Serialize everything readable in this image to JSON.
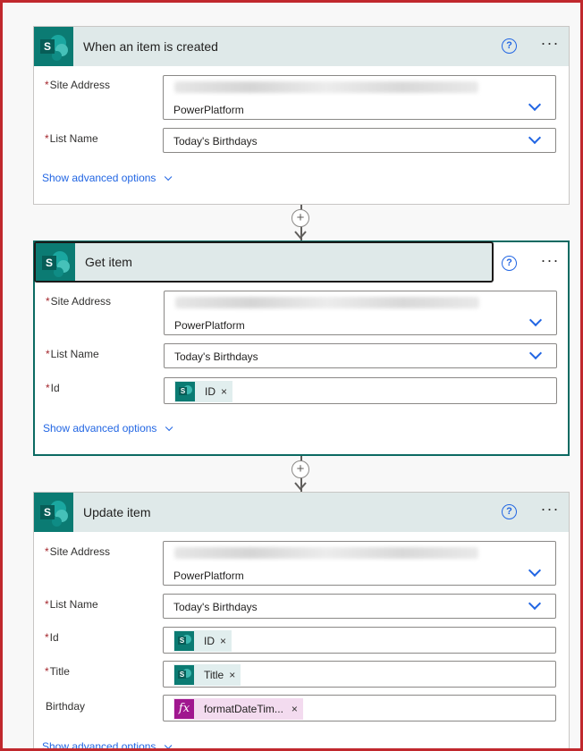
{
  "common": {
    "show_advanced": "Show advanced options",
    "help_glyph": "?",
    "more_glyph": "···",
    "close_glyph": "×"
  },
  "cards": [
    {
      "title": "When an item is created",
      "fields": {
        "site_label": "Site Address",
        "site_value": "PowerPlatform",
        "list_label": "List Name",
        "list_value": "Today's  Birthdays"
      }
    },
    {
      "title": "Get item",
      "fields": {
        "site_label": "Site Address",
        "site_value": "PowerPlatform",
        "list_label": "List Name",
        "list_value": "Today's  Birthdays",
        "id_label": "Id",
        "id_token": "ID"
      }
    },
    {
      "title": "Update item",
      "fields": {
        "site_label": "Site Address",
        "site_value": "PowerPlatform",
        "list_label": "List Name",
        "list_value": "Today's  Birthdays",
        "id_label": "Id",
        "id_token": "ID",
        "title_label": "Title",
        "title_token": "Title",
        "birthday_label": "Birthday",
        "birthday_token": "formatDateTim..."
      }
    }
  ],
  "icons": {
    "connector": "sharepoint-icon",
    "help": "help-icon",
    "more": "more-options-icon",
    "add": "plus-icon",
    "expression": "fx-icon"
  },
  "colors": {
    "accent": "#2266e3",
    "teal": "#0b7b73",
    "header_bg": "#dfe9e9",
    "required": "#a4262c",
    "frame": "#c0282d"
  }
}
